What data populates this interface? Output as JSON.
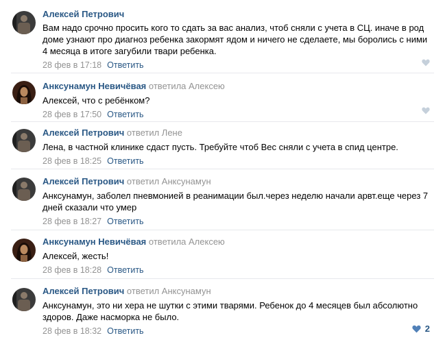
{
  "colors": {
    "link": "#2a5885",
    "muted": "#939393",
    "heart_active": "#5181b8",
    "heart_idle": "#c5d0db"
  },
  "comments": [
    {
      "author": "Алексей Петрович",
      "reply_to": "",
      "text": "Вам надо срочно просить кого то сдать за вас анализ, чтоб сняли с учета в СЦ. иначе в род доме узнают про диагноз ребенка закормят ядом и ничего не сделаете, мы боролись с ними 4 месяца в итоге загубили твари ребенка.",
      "date": "28 фев в 17:18",
      "reply_label": "Ответить",
      "like_icon": "heart-icon",
      "likes": ""
    },
    {
      "author": "Анксунамун Невичёвая",
      "reply_to": "ответила Алексею",
      "text": "Алексей, что с ребёнком?",
      "date": "28 фев в 17:50",
      "reply_label": "Ответить",
      "like_icon": "heart-icon",
      "likes": ""
    },
    {
      "author": "Алексей Петрович",
      "reply_to": "ответил Лене",
      "text": "Лена, в частной клинике сдаст пусть. Требуйте чтоб Вес сняли с учета в спид центре.",
      "date": "28 фев в 18:25",
      "reply_label": "Ответить",
      "like_icon": "heart-icon",
      "likes": ""
    },
    {
      "author": "Алексей Петрович",
      "reply_to": "ответил Анксунамун",
      "text": "Анксунамун, заболел пневмонией в реанимации был.через неделю начали арвт.еще через 7 дней сказали что умер",
      "date": "28 фев в 18:27",
      "reply_label": "Ответить",
      "like_icon": "heart-icon",
      "likes": ""
    },
    {
      "author": "Анксунамун Невичёвая",
      "reply_to": "ответила Алексею",
      "text": "Алексей, жесть!",
      "date": "28 фев в 18:28",
      "reply_label": "Ответить",
      "like_icon": "heart-icon",
      "likes": ""
    },
    {
      "author": "Алексей Петрович",
      "reply_to": "ответил Анксунамун",
      "text": "Анксунамун, это ни хера не шутки с этими тварями. Ребенок до 4 месяцев был абсолютно здоров. Даже насморка не было.",
      "date": "28 фев в 18:32",
      "reply_label": "Ответить",
      "like_icon": "heart-icon",
      "likes": "2"
    }
  ]
}
